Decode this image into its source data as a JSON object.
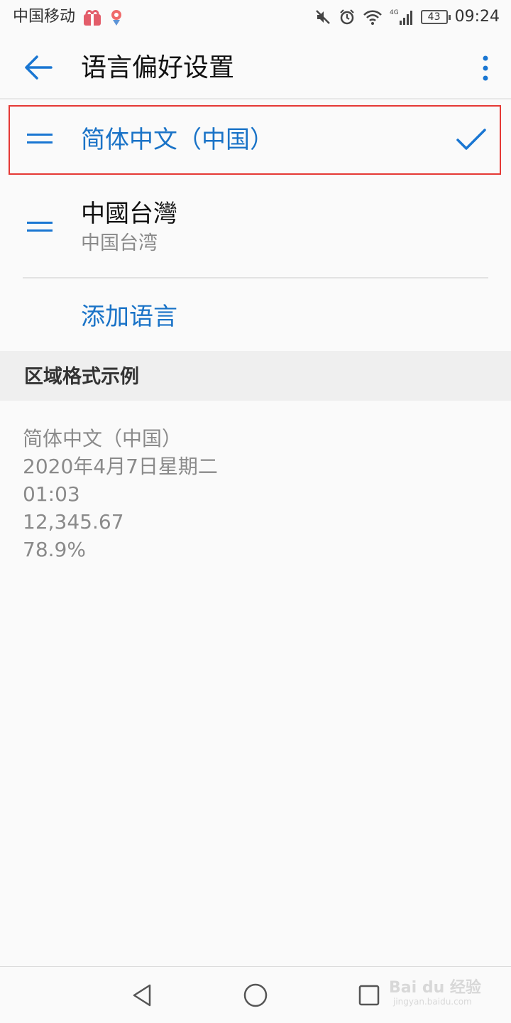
{
  "status_bar": {
    "carrier": "中国移动",
    "battery": "43",
    "time": "09:24"
  },
  "header": {
    "title": "语言偏好设置",
    "back_icon": "arrow-back-icon",
    "more_icon": "more-vert-icon"
  },
  "languages": [
    {
      "name": "简体中文（中国）",
      "selected": true,
      "handle_icon": "drag-handle-icon",
      "check_icon": "check-icon"
    },
    {
      "name": "中國台灣",
      "subtitle": "中国台湾",
      "selected": false,
      "handle_icon": "drag-handle-icon"
    }
  ],
  "add_language": "添加语言",
  "region_section": {
    "title": "区域格式示例",
    "examples": [
      "简体中文（中国）",
      "2020年4月7日星期二",
      "01:03",
      "12,345.67",
      "78.9%"
    ]
  },
  "nav_bar": {
    "icons": [
      "nav-back-icon",
      "nav-home-icon",
      "nav-recent-icon"
    ],
    "watermark": "Bai du 经验",
    "watermark_sub": "jingyan.baidu.com"
  },
  "colors": {
    "accent": "#1a73c7",
    "highlight": "#e53935"
  }
}
